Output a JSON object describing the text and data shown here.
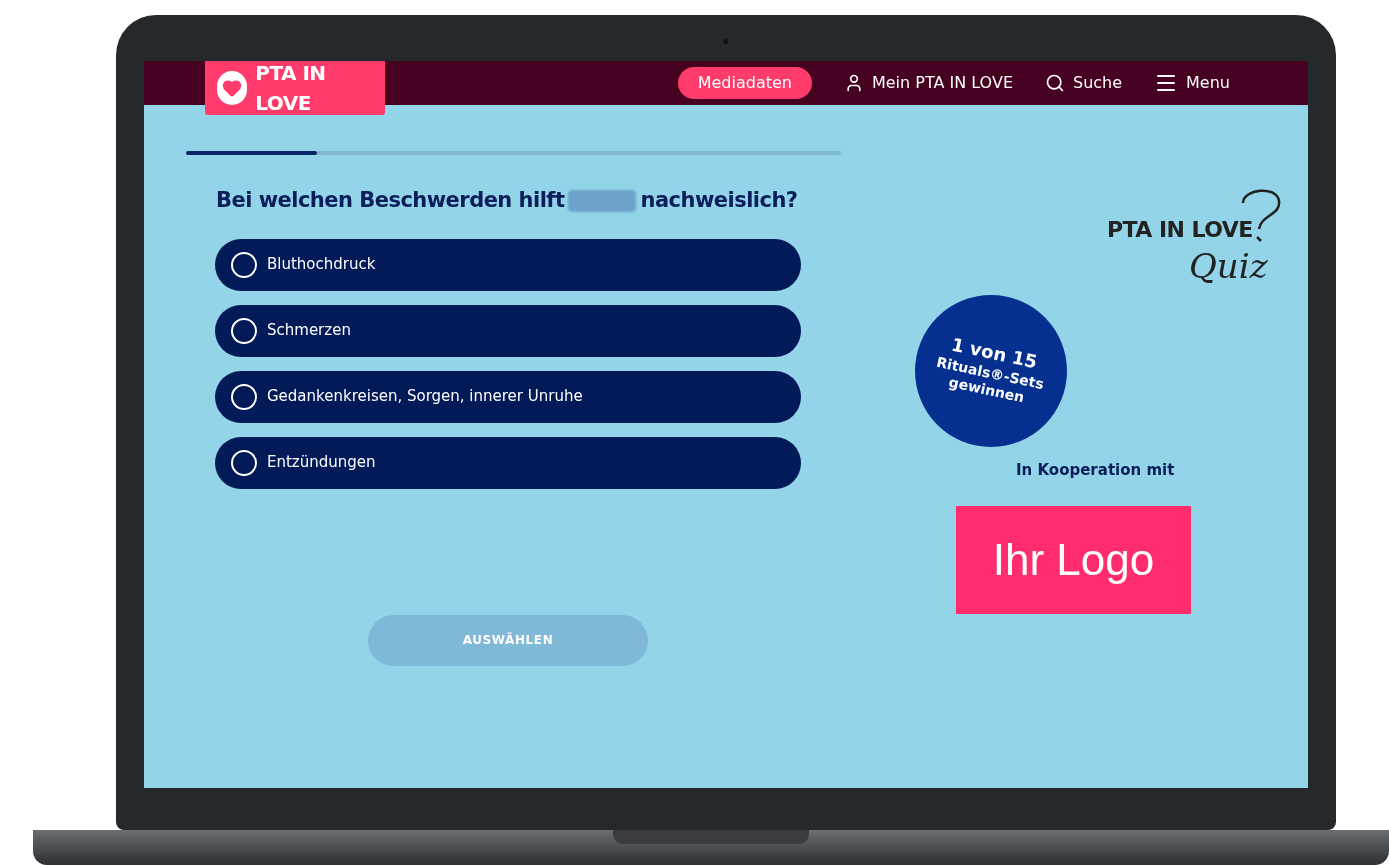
{
  "header": {
    "logo": "PTA IN LOVE",
    "nav": [
      {
        "kind": "pill",
        "label": "Mediadaten"
      },
      {
        "kind": "user",
        "label": "Mein PTA IN LOVE"
      },
      {
        "kind": "search",
        "label": "Suche"
      },
      {
        "kind": "menu",
        "label": "Menu"
      }
    ]
  },
  "progress": {
    "level": 0.2
  },
  "question": {
    "before": "Bei welchen Beschwerden hilft",
    "after": "nachweislich?"
  },
  "options": [
    {
      "label": "Bluthochdruck",
      "selected": false
    },
    {
      "label": "Schmerzen",
      "selected": false
    },
    {
      "label": "Gedankenkreisen, Sorgen, innerer Unruhe",
      "selected": false
    },
    {
      "label": "Entzündungen",
      "selected": false
    }
  ],
  "submit": {
    "label": "AUSWÄHLEN",
    "disabled": true
  },
  "quiz_logo": {
    "brand": "PTA IN LOVE",
    "word": "Quiz"
  },
  "prize_badge": [
    "1 von 15",
    "Rituals®-Sets",
    "gewinnen"
  ],
  "cooperation": "In Kooperation mit",
  "partner_logo": "Ihr Logo"
}
